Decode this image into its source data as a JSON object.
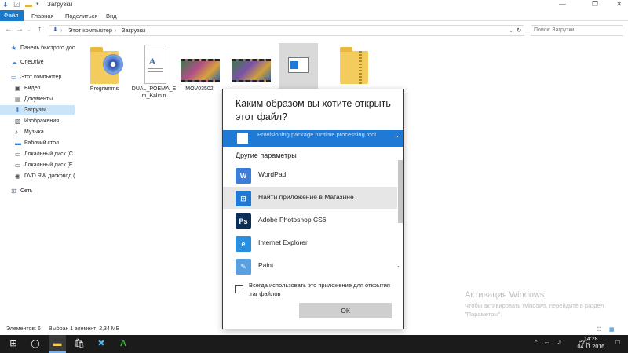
{
  "window": {
    "title": "Загрузки",
    "controls": [
      "minimize-icon",
      "maximize-icon",
      "close-icon"
    ]
  },
  "ribbon": {
    "tabs": [
      {
        "label": "Файл",
        "active": true
      },
      {
        "label": "Главная",
        "active": false
      },
      {
        "label": "Поделиться",
        "active": false
      },
      {
        "label": "Вид",
        "active": false
      }
    ]
  },
  "address": {
    "crumbs": [
      "Этот компьютер",
      "Загрузки"
    ],
    "search_placeholder": "Поиск: Загрузки"
  },
  "sidebar": {
    "items": [
      {
        "label": "Панель быстрого доступа",
        "icon": "star-icon"
      },
      {
        "label": "OneDrive",
        "icon": "cloud-icon"
      },
      {
        "label": "Этот компьютер",
        "icon": "computer-icon"
      },
      {
        "label": "Видео",
        "icon": "video-icon"
      },
      {
        "label": "Документы",
        "icon": "documents-icon"
      },
      {
        "label": "Загрузки",
        "icon": "downloads-icon",
        "selected": true
      },
      {
        "label": "Изображения",
        "icon": "pictures-icon"
      },
      {
        "label": "Музыка",
        "icon": "music-icon"
      },
      {
        "label": "Рабочий стол",
        "icon": "desktop-icon"
      },
      {
        "label": "Локальный диск (C",
        "icon": "drive-icon"
      },
      {
        "label": "Локальный диск (E",
        "icon": "drive-icon"
      },
      {
        "label": "DVD RW дисковод (",
        "icon": "dvd-icon"
      },
      {
        "label": "Сеть",
        "icon": "network-icon"
      }
    ]
  },
  "files": [
    {
      "name": "Programms",
      "type": "folder"
    },
    {
      "name": "DUAL_POEMA_E m_Kalinin",
      "type": "document"
    },
    {
      "name": "MOV03502",
      "type": "video"
    },
    {
      "name": "",
      "type": "video"
    },
    {
      "name": "",
      "type": "rar-selected"
    },
    {
      "name": "",
      "type": "zip-folder"
    }
  ],
  "status": {
    "count": "Элементов: 6",
    "selected": "Выбран 1 элемент: 2,34 МБ"
  },
  "dialog": {
    "title": "Каким образом вы хотите открыть этот файл?",
    "highlighted_item": "Provisioning package runtime processing tool",
    "other_header": "Другие параметры",
    "apps": [
      {
        "label": "WordPad",
        "icon": "wordpad-icon",
        "color": "#3b7dd8",
        "glyph": "W"
      },
      {
        "label": "Найти приложение в Магазине",
        "icon": "store-icon",
        "color": "#1e7ad4",
        "glyph": "⊞"
      },
      {
        "label": "Adobe Photoshop CS6",
        "icon": "photoshop-icon",
        "color": "#0d2f56",
        "glyph": "Ps"
      },
      {
        "label": "Internet Explorer",
        "icon": "internet-explorer-icon",
        "color": "#2b8fe0",
        "glyph": "e"
      },
      {
        "label": "Paint",
        "icon": "paint-icon",
        "color": "#5aa0e0",
        "glyph": "✎"
      }
    ],
    "always_use": "Всегда использовать это приложение для открытия .rar файлов",
    "always_checked": false,
    "ok_label": "ОК"
  },
  "watermark": {
    "title": "Активация Windows",
    "text": "Чтобы активировать Windows, перейдите в раздел \"Параметры\"."
  },
  "taskbar": {
    "language": "РУС",
    "time": "14:28",
    "date": "04.11.2016"
  },
  "colors": {
    "accent": "#1979ca",
    "selection": "#1e7ad4",
    "taskbar": "#1b1b1b"
  }
}
